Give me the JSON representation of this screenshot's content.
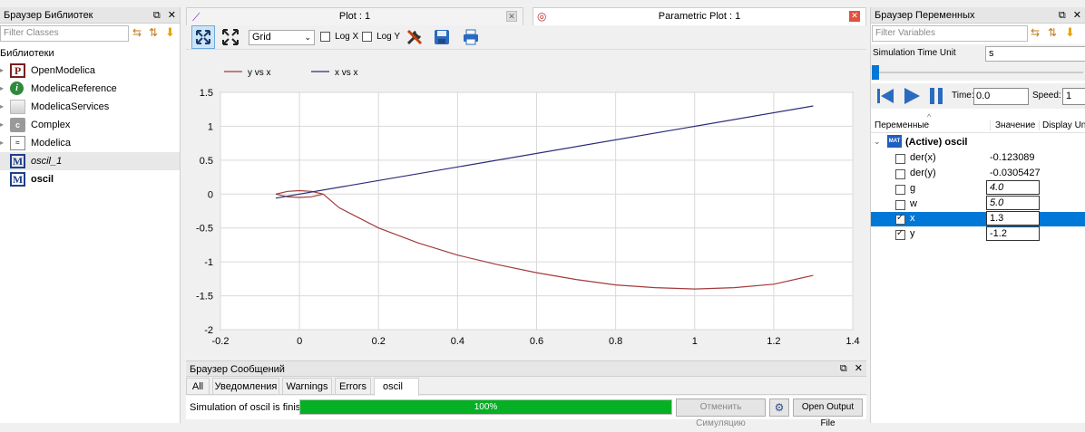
{
  "library_browser": {
    "title": "Браузер Библиотек",
    "filter_placeholder": "Filter Classes",
    "section_label": "Библиотеки",
    "items": [
      {
        "label": "OpenModelica"
      },
      {
        "label": "ModelicaReference"
      },
      {
        "label": "ModelicaServices"
      },
      {
        "label": "Complex"
      },
      {
        "label": "Modelica"
      },
      {
        "label": "oscil_1"
      },
      {
        "label": "oscil"
      }
    ]
  },
  "plot_tabs": {
    "tab1": "Plot : 1",
    "tab2": "Parametric Plot : 1"
  },
  "plot_toolbar": {
    "grid_select": "Grid",
    "logx": "Log X",
    "logy": "Log Y"
  },
  "chart_data": {
    "type": "line",
    "series": [
      {
        "name": "y vs x",
        "color": "#a23b3b",
        "x": [
          -0.06,
          -0.03,
          0.0,
          0.03,
          0.06,
          0.03,
          0.0,
          -0.03,
          -0.06,
          -0.03,
          0.0,
          0.03,
          0.06,
          0.1,
          0.2,
          0.3,
          0.4,
          0.5,
          0.6,
          0.7,
          0.8,
          0.9,
          1.0,
          1.1,
          1.2,
          1.3
        ],
        "y": [
          0.0,
          0.04,
          0.05,
          0.04,
          0.0,
          -0.04,
          -0.05,
          -0.04,
          0.0,
          0.04,
          0.05,
          0.04,
          0.0,
          -0.2,
          -0.5,
          -0.72,
          -0.9,
          -1.04,
          -1.16,
          -1.26,
          -1.34,
          -1.38,
          -1.4,
          -1.38,
          -1.33,
          -1.2
        ]
      },
      {
        "name": "x vs x",
        "color": "#2a2a7a",
        "x": [
          -0.06,
          1.3
        ],
        "y": [
          -0.06,
          1.3
        ]
      }
    ],
    "xlim": [
      -0.2,
      1.4
    ],
    "ylim": [
      -2,
      1.5
    ],
    "xticks": [
      "-0.2",
      "0",
      "0.2",
      "0.4",
      "0.6",
      "0.8",
      "1",
      "1.2",
      "1.4"
    ],
    "xtick_values": [
      -0.2,
      0,
      0.2,
      0.4,
      0.6,
      0.8,
      1,
      1.2,
      1.4
    ],
    "yticks": [
      "1.5",
      "1",
      "0.5",
      "0",
      "-0.5",
      "-1",
      "-1.5",
      "-2"
    ],
    "ytick_values": [
      1.5,
      1,
      0.5,
      0,
      -0.5,
      -1,
      -1.5,
      -2
    ],
    "grid": true,
    "legend_position": "top-left"
  },
  "messages": {
    "title": "Браузер Сообщений",
    "tabs": [
      "All",
      "Уведомления",
      "Warnings",
      "Errors",
      "oscil"
    ],
    "status": "Simulation of oscil is finished.",
    "progress_text": "100%",
    "progress": 1.0,
    "cancel_button": "Отменить Симуляцию",
    "open_output_button": "Open Output File"
  },
  "variables": {
    "title": "Браузер Переменных",
    "filter_placeholder": "Filter Variables",
    "time_unit_label": "Simulation Time Unit",
    "time_unit_value": "s",
    "time_label": "Time:",
    "time_value": "0.0",
    "speed_label": "Speed:",
    "speed_value": "1",
    "columns": [
      "Переменные",
      "Значение",
      "Display Unit"
    ],
    "root_label": "(Active) oscil",
    "rows": [
      {
        "name": "der(x)",
        "value": "-0.123089",
        "checked": false,
        "editable": false
      },
      {
        "name": "der(y)",
        "value": "-0.0305427",
        "checked": false,
        "editable": false
      },
      {
        "name": "g",
        "value": "4.0",
        "checked": false,
        "editable": true
      },
      {
        "name": "w",
        "value": "5.0",
        "checked": false,
        "editable": true
      },
      {
        "name": "x",
        "value": "1.3",
        "checked": true,
        "editable": true
      },
      {
        "name": "y",
        "value": "-1.2",
        "checked": true,
        "editable": true
      }
    ]
  },
  "colors": {
    "accent": "#0078d7",
    "progress": "#06b025",
    "series_red": "#a23b3b",
    "series_blue": "#2a2a7a"
  }
}
